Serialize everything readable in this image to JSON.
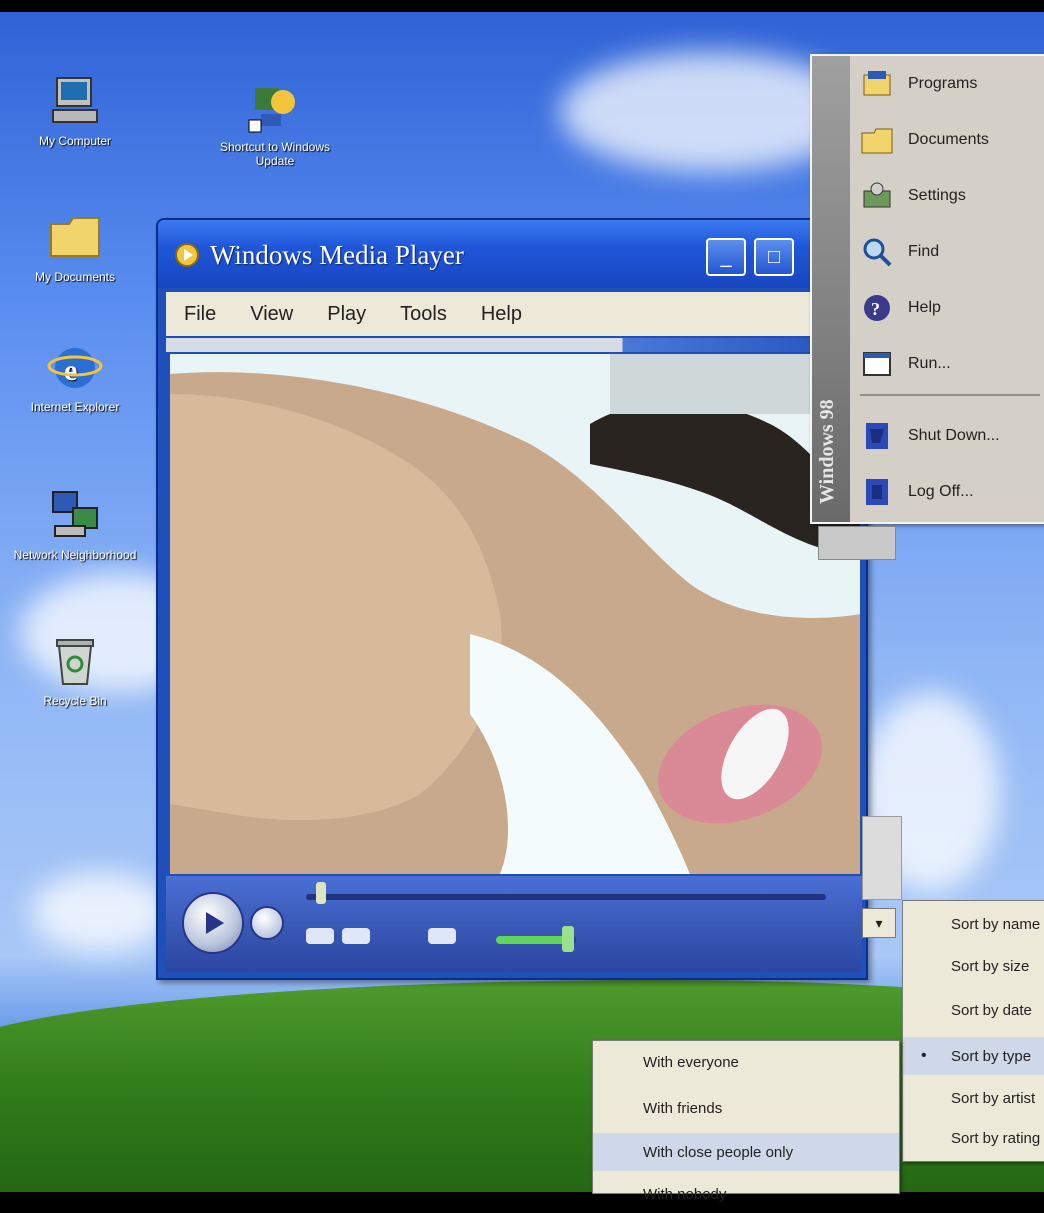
{
  "desktop": {
    "icons": [
      {
        "label": "My Computer",
        "icon": "computer-icon"
      },
      {
        "label": "Shortcut to Windows Update",
        "icon": "update-shortcut-icon"
      },
      {
        "label": "My Documents",
        "icon": "folder-icon"
      },
      {
        "label": "Internet Explorer",
        "icon": "internet-explorer-icon"
      },
      {
        "label": "Network Neighborhood",
        "icon": "network-icon"
      },
      {
        "label": "Recycle Bin",
        "icon": "recycle-bin-icon"
      }
    ]
  },
  "wmp": {
    "title": "Windows Media Player",
    "menu": [
      "File",
      "View",
      "Play",
      "Tools",
      "Help"
    ],
    "minimize_glyph": "_",
    "maximize_glyph": "□"
  },
  "start_menu": {
    "band_text": "Windows 98",
    "items": [
      {
        "label": "Programs",
        "icon": "programs-icon"
      },
      {
        "label": "Documents",
        "icon": "documents-icon"
      },
      {
        "label": "Settings",
        "icon": "settings-icon"
      },
      {
        "label": "Find",
        "icon": "find-icon"
      },
      {
        "label": "Help",
        "icon": "help-icon"
      },
      {
        "label": "Run...",
        "icon": "run-icon"
      },
      {
        "label": "Shut Down...",
        "icon": "shutdown-icon"
      },
      {
        "label": "Log Off...",
        "icon": "logoff-icon"
      }
    ]
  },
  "context_right": {
    "items": [
      "Sort by name",
      "Sort by size",
      "Sort by date",
      "Sort by type",
      "Sort by artist",
      "Sort by rating"
    ],
    "checked_index": 3,
    "dropdown_glyph": "▾"
  },
  "context_bottom": {
    "items": [
      "With everyone",
      "With friends",
      "With close people only",
      "With nobody"
    ]
  },
  "colors": {
    "titlebar": "#1f56d9",
    "menubar": "#ece9d8",
    "startmenu": "#d4d0c8",
    "controls": "#3a5ab8"
  }
}
